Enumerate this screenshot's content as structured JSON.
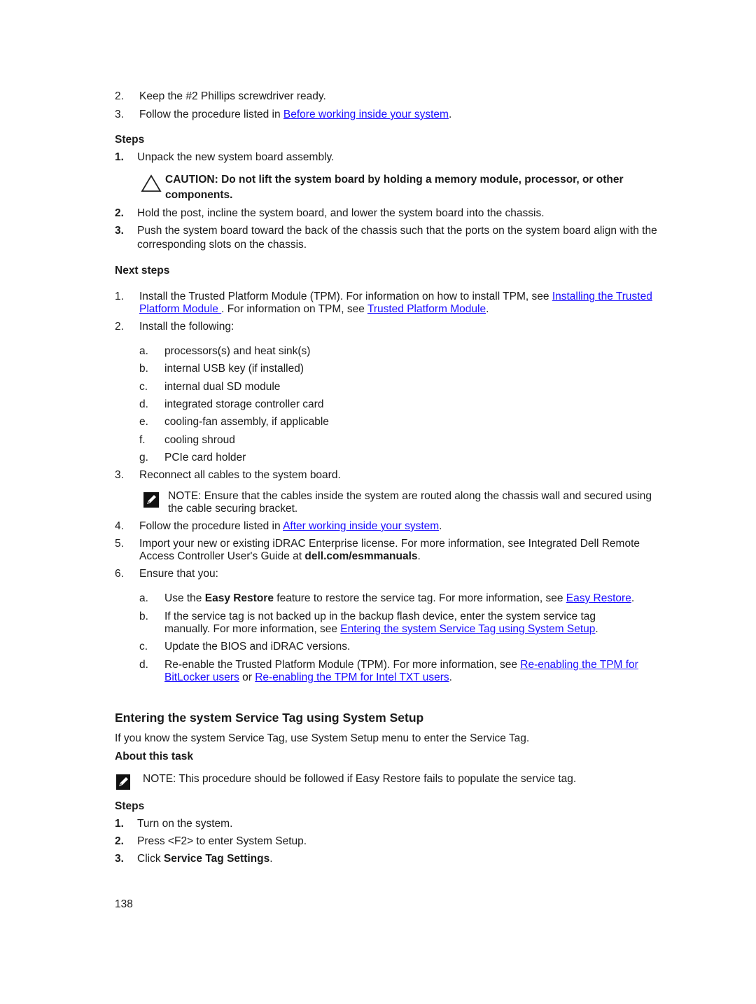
{
  "prereq": {
    "items": [
      {
        "num": "2.",
        "text": "Keep the #2 Phillips screwdriver ready."
      },
      {
        "num": "3.",
        "text_before": "Follow the procedure listed in ",
        "link": "Before working inside your system",
        "text_after": "."
      }
    ]
  },
  "steps1": {
    "heading": "Steps",
    "items": [
      {
        "num": "1.",
        "text": "Unpack the new system board assembly."
      },
      {
        "num": "2.",
        "text": "Hold the post, incline the system board, and lower the system board into the chassis."
      },
      {
        "num": "3.",
        "text": "Push the system board toward the back of the chassis such that the ports on the system board align with the corresponding slots on the chassis."
      }
    ],
    "caution": {
      "icon": "caution-triangle-icon",
      "text": "CAUTION: Do not lift the system board by holding a memory module, processor, or other components."
    }
  },
  "next_steps": {
    "heading": "Next steps",
    "item1": {
      "num": "1.",
      "text_a": "Install the Trusted Platform Module (TPM). For information on how to install TPM, see ",
      "link_a": "Installing the Trusted Platform Module ",
      "text_b": ". For information on TPM, see ",
      "link_b": "Trusted Platform Module",
      "text_c": "."
    },
    "item2": {
      "num": "2.",
      "text": "Install the following:",
      "sub": [
        {
          "letter": "a.",
          "text": "processors(s) and heat sink(s)"
        },
        {
          "letter": "b.",
          "text": "internal USB key (if installed)"
        },
        {
          "letter": "c.",
          "text": "internal dual SD module"
        },
        {
          "letter": "d.",
          "text": "integrated storage controller card"
        },
        {
          "letter": "e.",
          "text": "cooling-fan assembly, if applicable"
        },
        {
          "letter": "f.",
          "text": "cooling shroud"
        },
        {
          "letter": "g.",
          "text": "PCIe card holder"
        }
      ]
    },
    "item3": {
      "num": "3.",
      "text": "Reconnect all cables to the system board.",
      "note_label": "NOTE:",
      "note_text": " Ensure that the cables inside the system are routed along the chassis wall and secured using the cable securing bracket."
    },
    "item4": {
      "num": "4.",
      "text_before": "Follow the procedure listed in ",
      "link": "After working inside your system",
      "text_after": "."
    },
    "item5": {
      "num": "5.",
      "text_before": "Import your new or existing iDRAC Enterprise license. For more information, see Integrated Dell Remote Access Controller User's Guide at ",
      "bold": "dell.com/esmmanuals",
      "text_after": "."
    },
    "item6": {
      "num": "6.",
      "text": "Ensure that you:",
      "a": {
        "letter": "a.",
        "t1": "Use the ",
        "bold": "Easy Restore",
        "t2": " feature to restore the service tag. For more information, see ",
        "link": "Easy Restore",
        "t3": "."
      },
      "b": {
        "letter": "b.",
        "t1": "If the service tag is not backed up in the backup flash device, enter the system service tag manually. For more information, see ",
        "link": "Entering the system Service Tag using System Setup",
        "t2": "."
      },
      "c": {
        "letter": "c.",
        "text": "Update the BIOS and iDRAC versions."
      },
      "d": {
        "letter": "d.",
        "t1": "Re-enable the Trusted Platform Module (TPM). For more information, see ",
        "link1": "Re-enabling the TPM for BitLocker users",
        "t2": " or ",
        "link2": "Re-enabling the TPM for Intel TXT users",
        "t3": "."
      }
    }
  },
  "section2": {
    "title": "Entering the system Service Tag using System Setup",
    "intro": "If you know the system Service Tag, use System Setup menu to enter the Service Tag.",
    "about_heading": "About this task",
    "note_label": "NOTE:",
    "note_text": " This procedure should be followed if Easy Restore fails to populate the service tag.",
    "steps_heading": "Steps",
    "steps": [
      {
        "num": "1.",
        "text": "Turn on the system."
      },
      {
        "num": "2.",
        "text": "Press <F2> to enter System Setup."
      },
      {
        "num": "3.",
        "text_before": "Click ",
        "bold": "Service Tag Settings",
        "text_after": "."
      }
    ]
  },
  "footer": {
    "page_number": "138"
  }
}
